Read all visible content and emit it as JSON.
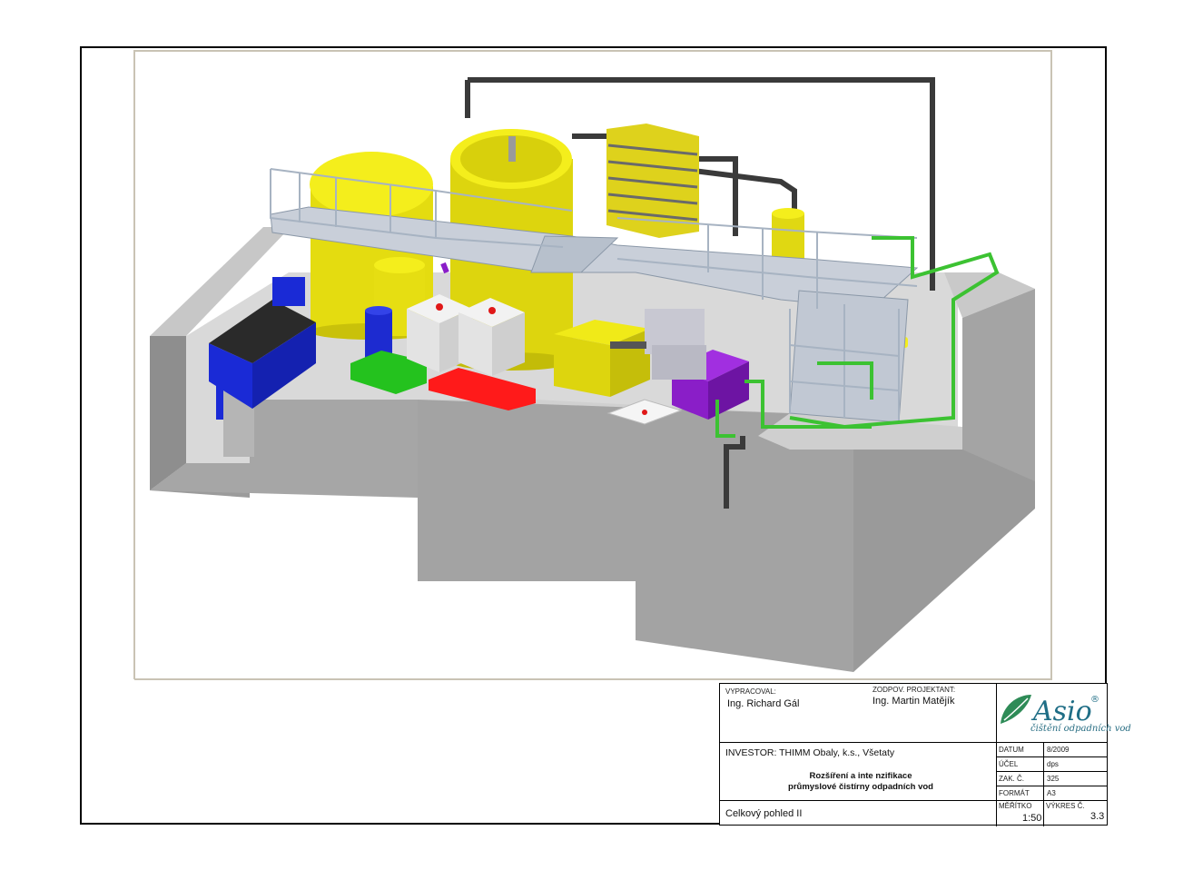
{
  "title_block": {
    "vypracoval_label": "VYPRACOVAL:",
    "vypracoval_name": "Ing. Richard Gál",
    "zodpov_label": "ZODPOV. PROJEKTANT:",
    "zodpov_name": "Ing. Martin Matějík",
    "investor": "INVESTOR: THIMM Obaly, k.s., Všetaty",
    "project_line1": "Rozšíření a inte nzifikace",
    "project_line2": "průmyslové čistírny odpadních vod",
    "drawing_title": "Celkový pohled II",
    "fields": [
      {
        "label": "DATUM",
        "value": "8/2009"
      },
      {
        "label": "ÚČEL",
        "value": "dps"
      },
      {
        "label": "ZAK. Č.",
        "value": "325"
      },
      {
        "label": "FORMÁT",
        "value": "A3"
      }
    ],
    "meritko_label": "MĚŘÍTKO",
    "meritko_value": "1:50",
    "vykres_label": "VÝKRES Č.",
    "vykres_value": "3.3"
  },
  "logo": {
    "text": "Asio",
    "registered": "®",
    "tagline": "čištění odpadních vod",
    "color_green": "#2e8b57",
    "color_blue": "#1f6e86"
  },
  "colors": {
    "concrete_light": "#d4d4d4",
    "concrete_mid": "#a9a9a9",
    "concrete_dark": "#8a8a8a",
    "tank_yellow": "#f4ee1c",
    "filter_press_blue": "#1a2ad6",
    "pipe_green": "#3cc232",
    "pallet_red": "#ff1a1a",
    "dosing_purple": "#8a1ec8",
    "pipe_dark": "#3a3a3a"
  }
}
